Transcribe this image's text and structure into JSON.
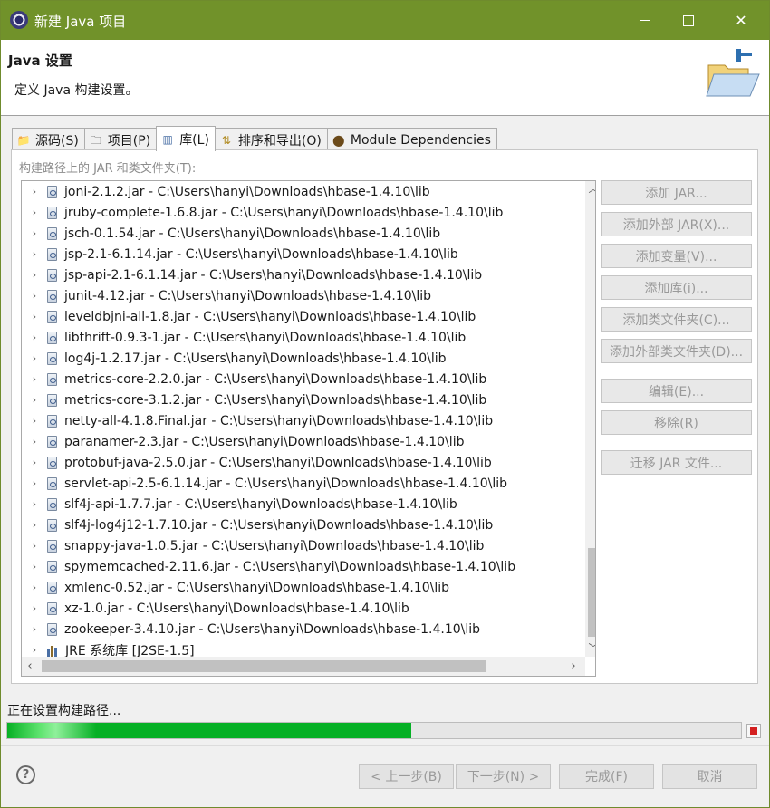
{
  "window": {
    "title": "新建 Java 项目"
  },
  "banner": {
    "title": "Java 设置",
    "description": "定义 Java 构建设置。"
  },
  "tabs": [
    {
      "label": "源码(S)",
      "icon": "source-folder-icon",
      "active": false
    },
    {
      "label": "项目(P)",
      "icon": "project-folder-icon",
      "active": false
    },
    {
      "label": "库(L)",
      "icon": "library-icon",
      "active": true
    },
    {
      "label": "排序和导出(O)",
      "icon": "order-export-icon",
      "active": false
    },
    {
      "label": "Module Dependencies",
      "icon": "module-icon",
      "active": false
    }
  ],
  "libraries": {
    "label": "构建路径上的 JAR 和类文件夹(T):",
    "items": [
      {
        "name": "joni-2.1.2.jar",
        "path": "C:\\Users\\hanyi\\Downloads\\hbase-1.4.10\\lib"
      },
      {
        "name": "jruby-complete-1.6.8.jar",
        "path": "C:\\Users\\hanyi\\Downloads\\hbase-1.4.10\\lib"
      },
      {
        "name": "jsch-0.1.54.jar",
        "path": "C:\\Users\\hanyi\\Downloads\\hbase-1.4.10\\lib"
      },
      {
        "name": "jsp-2.1-6.1.14.jar",
        "path": "C:\\Users\\hanyi\\Downloads\\hbase-1.4.10\\lib"
      },
      {
        "name": "jsp-api-2.1-6.1.14.jar",
        "path": "C:\\Users\\hanyi\\Downloads\\hbase-1.4.10\\lib"
      },
      {
        "name": "junit-4.12.jar",
        "path": "C:\\Users\\hanyi\\Downloads\\hbase-1.4.10\\lib"
      },
      {
        "name": "leveldbjni-all-1.8.jar",
        "path": "C:\\Users\\hanyi\\Downloads\\hbase-1.4.10\\lib"
      },
      {
        "name": "libthrift-0.9.3-1.jar",
        "path": "C:\\Users\\hanyi\\Downloads\\hbase-1.4.10\\lib"
      },
      {
        "name": "log4j-1.2.17.jar",
        "path": "C:\\Users\\hanyi\\Downloads\\hbase-1.4.10\\lib"
      },
      {
        "name": "metrics-core-2.2.0.jar",
        "path": "C:\\Users\\hanyi\\Downloads\\hbase-1.4.10\\lib"
      },
      {
        "name": "metrics-core-3.1.2.jar",
        "path": "C:\\Users\\hanyi\\Downloads\\hbase-1.4.10\\lib"
      },
      {
        "name": "netty-all-4.1.8.Final.jar",
        "path": "C:\\Users\\hanyi\\Downloads\\hbase-1.4.10\\lib"
      },
      {
        "name": "paranamer-2.3.jar",
        "path": "C:\\Users\\hanyi\\Downloads\\hbase-1.4.10\\lib"
      },
      {
        "name": "protobuf-java-2.5.0.jar",
        "path": "C:\\Users\\hanyi\\Downloads\\hbase-1.4.10\\lib"
      },
      {
        "name": "servlet-api-2.5-6.1.14.jar",
        "path": "C:\\Users\\hanyi\\Downloads\\hbase-1.4.10\\lib"
      },
      {
        "name": "slf4j-api-1.7.7.jar",
        "path": "C:\\Users\\hanyi\\Downloads\\hbase-1.4.10\\lib"
      },
      {
        "name": "slf4j-log4j12-1.7.10.jar",
        "path": "C:\\Users\\hanyi\\Downloads\\hbase-1.4.10\\lib"
      },
      {
        "name": "snappy-java-1.0.5.jar",
        "path": "C:\\Users\\hanyi\\Downloads\\hbase-1.4.10\\lib"
      },
      {
        "name": "spymemcached-2.11.6.jar",
        "path": "C:\\Users\\hanyi\\Downloads\\hbase-1.4.10\\lib"
      },
      {
        "name": "xmlenc-0.52.jar",
        "path": "C:\\Users\\hanyi\\Downloads\\hbase-1.4.10\\lib"
      },
      {
        "name": "xz-1.0.jar",
        "path": "C:\\Users\\hanyi\\Downloads\\hbase-1.4.10\\lib"
      },
      {
        "name": "zookeeper-3.4.10.jar",
        "path": "C:\\Users\\hanyi\\Downloads\\hbase-1.4.10\\lib"
      }
    ],
    "jre": "JRE 系统库 [J2SE-1.5]",
    "separator": " - "
  },
  "side_buttons": [
    "添加 JAR...",
    "添加外部 JAR(X)...",
    "添加变量(V)...",
    "添加库(i)...",
    "添加类文件夹(C)...",
    "添加外部类文件夹(D)...",
    "编辑(E)...",
    "移除(R)",
    "迁移 JAR 文件..."
  ],
  "status": {
    "text": "正在设置构建路径...",
    "progress_percent": 55
  },
  "footer": {
    "help": "?",
    "back": "< 上一步(B)",
    "next": "下一步(N) >",
    "finish": "完成(F)",
    "cancel": "取消"
  },
  "colors": {
    "titlebar": "#71922a",
    "progress": "#06b025",
    "stop": "#d42020"
  }
}
